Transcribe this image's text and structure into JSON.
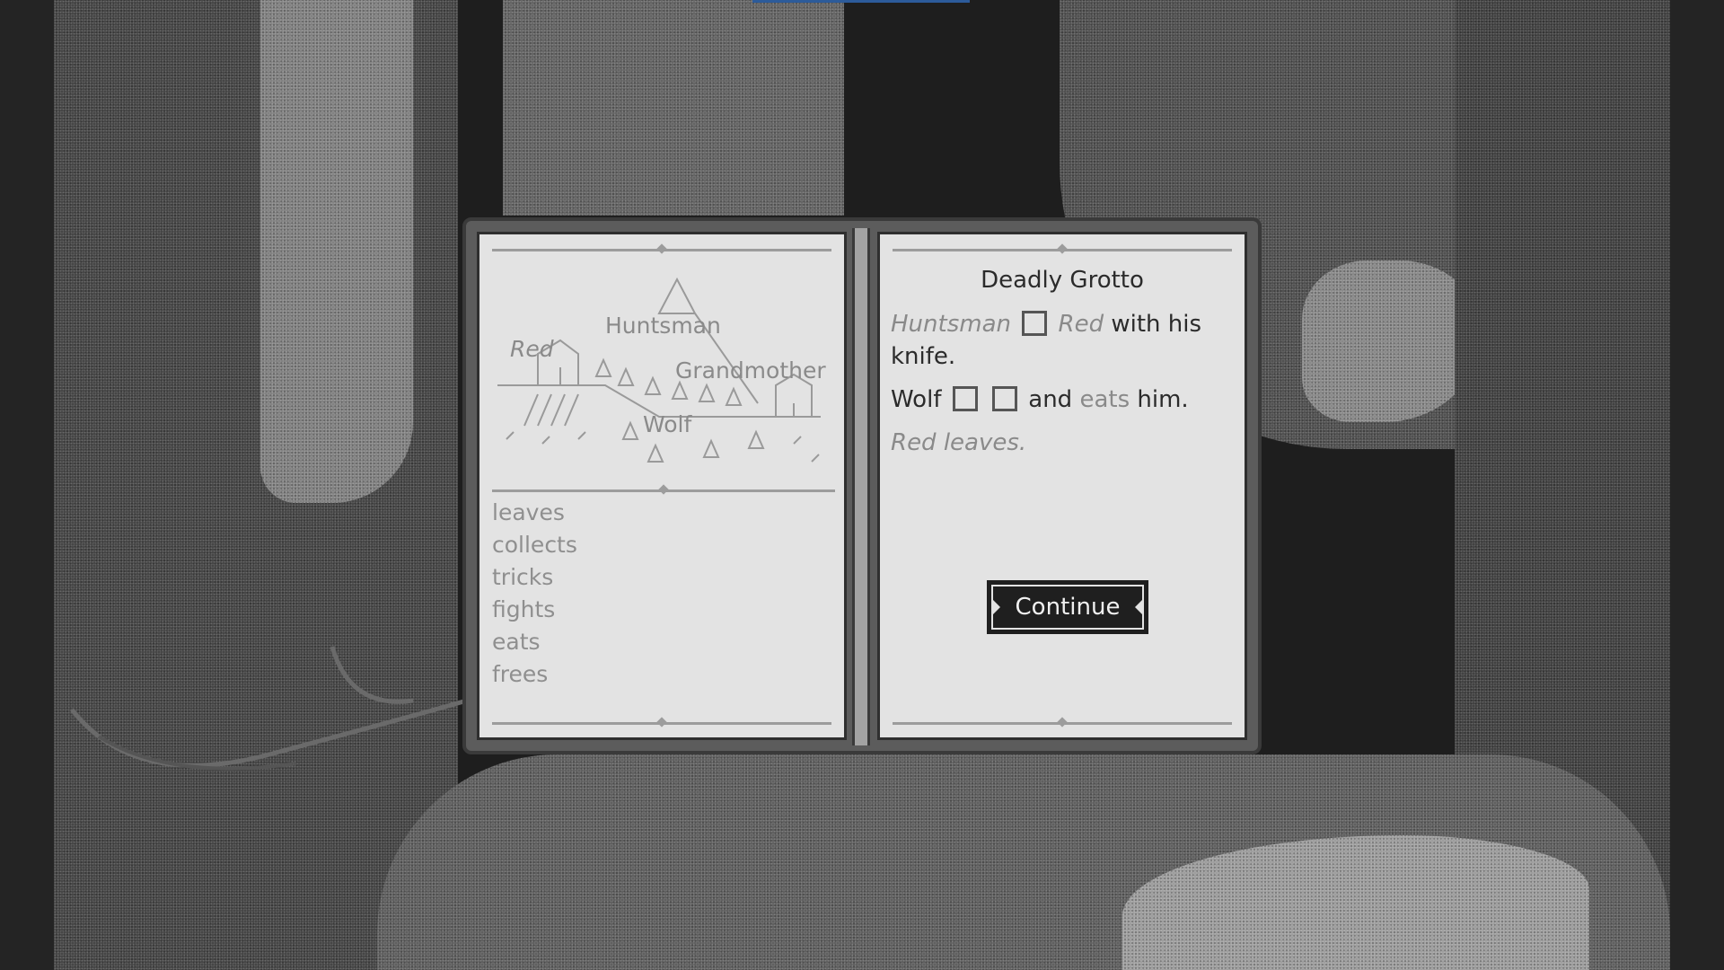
{
  "scene": {
    "name": "forest-grotto-background"
  },
  "map": {
    "labels": [
      "Red",
      "Huntsman",
      "Grandmother",
      "Wolf"
    ]
  },
  "verbs": [
    "leaves",
    "collects",
    "tricks",
    "fights",
    "eats",
    "frees"
  ],
  "story": {
    "title": "Deadly Grotto",
    "line1": {
      "subject": "Huntsman",
      "object": "Red",
      "tail": "with his",
      "tail2": "knife."
    },
    "line2": {
      "subject": "Wolf",
      "tail": "and",
      "tail_faded": "eats",
      "tail_end": "him."
    },
    "line3": "Red leaves."
  },
  "continue_label": "Continue",
  "colors": {
    "page": "#e3e3e3",
    "ink": "#2b2b2b",
    "faded_ink": "#8a8a8a",
    "button": "#1f1f1f",
    "marker": "#2c5b9a"
  }
}
